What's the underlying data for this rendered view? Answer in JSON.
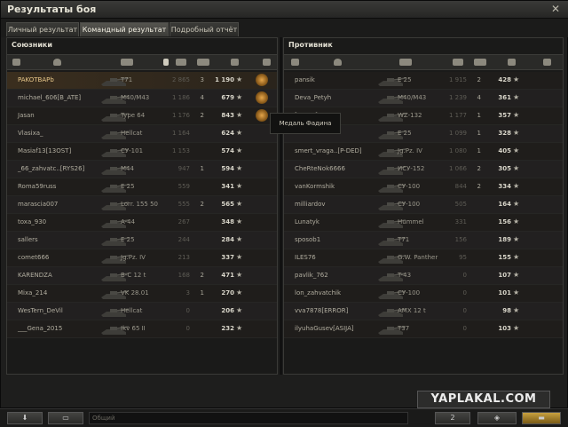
{
  "window": {
    "title": "Результаты боя",
    "close_glyph": "✕"
  },
  "tabs": [
    {
      "label": "Личный результат",
      "active": false
    },
    {
      "label": "Командный результат",
      "active": true
    },
    {
      "label": "Подробный отчёт",
      "active": false
    }
  ],
  "allies": {
    "title": "Союзники",
    "rows": [
      {
        "name": "PAKOTBAPb",
        "tank": "T71",
        "damage": "2 865",
        "kills": "3",
        "xp": "1 190",
        "medal": true,
        "highlight": true
      },
      {
        "name": "michael_606[B_ATE]",
        "tank": "M40/M43",
        "damage": "1 186",
        "kills": "4",
        "xp": "679",
        "medal": true
      },
      {
        "name": "Jasan",
        "tank": "Type 64",
        "damage": "1 176",
        "kills": "2",
        "xp": "843",
        "medal": true
      },
      {
        "name": "Vlasixa_",
        "tank": "Hellcat",
        "damage": "1 164",
        "kills": "",
        "xp": "624"
      },
      {
        "name": "Masiaf13[13OST]",
        "tank": "СУ-101",
        "damage": "1 153",
        "kills": "",
        "xp": "574"
      },
      {
        "name": "_66_zahvatc..[RYS26]",
        "tank": "M44",
        "damage": "947",
        "kills": "1",
        "xp": "594"
      },
      {
        "name": "Roma59russ",
        "tank": "E 25",
        "damage": "559",
        "kills": "",
        "xp": "341"
      },
      {
        "name": "marascia007",
        "tank": "Lorr. 155 50",
        "damage": "555",
        "kills": "2",
        "xp": "565"
      },
      {
        "name": "toxa_930",
        "tank": "A-44",
        "damage": "267",
        "kills": "",
        "xp": "348"
      },
      {
        "name": "sallers",
        "tank": "E 25",
        "damage": "244",
        "kills": "",
        "xp": "284"
      },
      {
        "name": "comet666",
        "tank": "Jg.Pz. IV",
        "damage": "213",
        "kills": "",
        "xp": "337"
      },
      {
        "name": "KARENDZA",
        "tank": "B-C 12 t",
        "damage": "168",
        "kills": "2",
        "xp": "471"
      },
      {
        "name": "Mixa_214",
        "tank": "VK 28.01",
        "damage": "3",
        "kills": "1",
        "xp": "270"
      },
      {
        "name": "WesTern_DeVil",
        "tank": "Hellcat",
        "damage": "0",
        "kills": "",
        "xp": "206"
      },
      {
        "name": "___Gena_2015",
        "tank": "Ikv 65 II",
        "damage": "0",
        "kills": "",
        "xp": "232"
      }
    ]
  },
  "enemies": {
    "title": "Противник",
    "rows": [
      {
        "name": "pansik",
        "tank": "E 25",
        "damage": "1 915",
        "kills": "2",
        "xp": "428"
      },
      {
        "name": "Deva_Petyh",
        "tank": "M40/M43",
        "damage": "1 239",
        "kills": "4",
        "xp": "361"
      },
      {
        "name": "[-DLW-]",
        "tank": "WZ-132",
        "damage": "1 177",
        "kills": "1",
        "xp": "357"
      },
      {
        "name": "",
        "tank": "E 25",
        "damage": "1 099",
        "kills": "1",
        "xp": "328"
      },
      {
        "name": "smert_vraga..[P-DED]",
        "tank": "Jg.Pz. IV",
        "damage": "1 080",
        "kills": "1",
        "xp": "405"
      },
      {
        "name": "CheRteNok6666",
        "tank": "ИСУ-152",
        "damage": "1 066",
        "kills": "2",
        "xp": "305"
      },
      {
        "name": "vanKormshik",
        "tank": "СУ-100",
        "damage": "844",
        "kills": "2",
        "xp": "334"
      },
      {
        "name": "milliardov",
        "tank": "СУ-100",
        "damage": "505",
        "kills": "",
        "xp": "164"
      },
      {
        "name": "Lunatyk",
        "tank": "Hummel",
        "damage": "331",
        "kills": "",
        "xp": "156"
      },
      {
        "name": "sposob1",
        "tank": "T71",
        "damage": "156",
        "kills": "",
        "xp": "189"
      },
      {
        "name": "ILES76",
        "tank": "G.W. Panther",
        "damage": "95",
        "kills": "",
        "xp": "155"
      },
      {
        "name": "pavlik_762",
        "tank": "T-43",
        "damage": "0",
        "kills": "",
        "xp": "107"
      },
      {
        "name": "lon_zahvatchik",
        "tank": "СУ-100",
        "damage": "0",
        "kills": "",
        "xp": "101"
      },
      {
        "name": "vva7878[ERROR]",
        "tank": "AMX 12 t",
        "damage": "0",
        "kills": "",
        "xp": "98"
      },
      {
        "name": "ilyuhaGusev[ASIJA]",
        "tank": "T37",
        "damage": "0",
        "kills": "",
        "xp": "103"
      }
    ]
  },
  "tooltip": {
    "text": "Медаль Фадина"
  },
  "star_glyph": "★",
  "bottom": {
    "chat_placeholder": "Общий",
    "counter": "2",
    "download_glyph": "⬇",
    "eye_glyph": "◈",
    "flag_glyph": "▬"
  },
  "watermark": "YAPLAKAL.COM"
}
